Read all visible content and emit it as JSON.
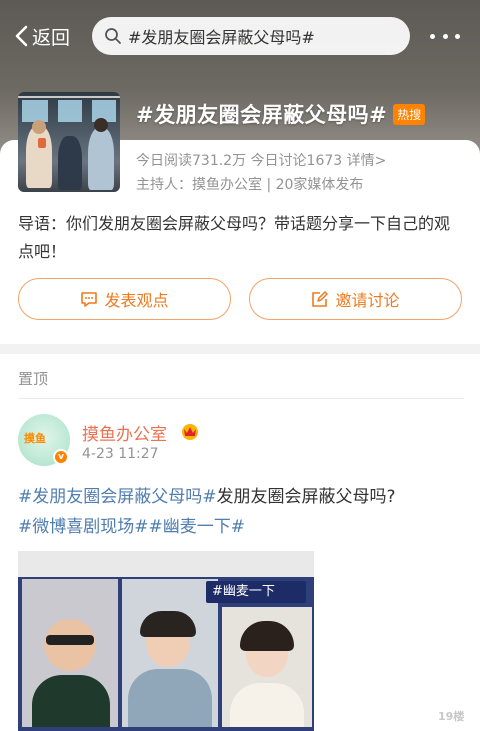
{
  "nav": {
    "back_label": "返回",
    "search_value": "#发朋友圈会屏蔽父母吗#"
  },
  "topic": {
    "title": "#发朋友圈会屏蔽父母吗#",
    "hot_badge": "热搜",
    "reads": "今日阅读731.2万",
    "discussions": "今日讨论1673",
    "details_link": "详情>",
    "host": "主持人：摸鱼办公室 | 20家媒体发布",
    "intro": "导语：你们发朋友圈会屏蔽父母吗？带话题分享一下自己的观点吧！",
    "post_button": "发表观点",
    "invite_button": "邀请讨论"
  },
  "pinned": {
    "section_label": "置顶",
    "username": "摸鱼办公室",
    "time": "4-23 11:27",
    "text_parts": [
      {
        "text": "#发朋友圈会屏蔽父母吗#",
        "tag": true
      },
      {
        "text": "发朋友圈会屏蔽父母吗?",
        "tag": false
      },
      {
        "text": "#微博喜剧现场#",
        "tag": true
      },
      {
        "text": "#幽麦一下#",
        "tag": true
      }
    ],
    "media_tag": "#幽麦一下"
  },
  "colors": {
    "accent": "#ff8200",
    "button_text": "#ef7a1f",
    "username": "#eb7350",
    "hashtag": "#507daf"
  },
  "icons": [
    "back-chevron-icon",
    "search-icon",
    "more-icon",
    "comment-icon",
    "edit-icon",
    "vip-crown-icon",
    "verified-icon"
  ]
}
